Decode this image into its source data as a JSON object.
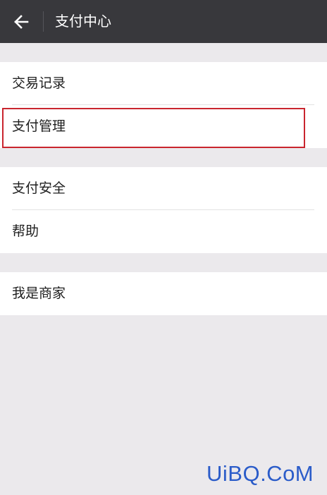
{
  "header": {
    "title": "支付中心",
    "back_icon": "arrow-left-icon"
  },
  "groups": [
    {
      "items": [
        "交易记录",
        "支付管理"
      ]
    },
    {
      "items": [
        "支付安全",
        "帮助"
      ]
    },
    {
      "items": [
        "我是商家"
      ]
    }
  ],
  "highlighted_item": "支付管理",
  "colors": {
    "header_bg": "#38383c",
    "page_bg": "#ebe9ec",
    "highlight_border": "#c9252e",
    "watermark": "#2b5cc9"
  },
  "watermark": "UiBQ.CoM"
}
